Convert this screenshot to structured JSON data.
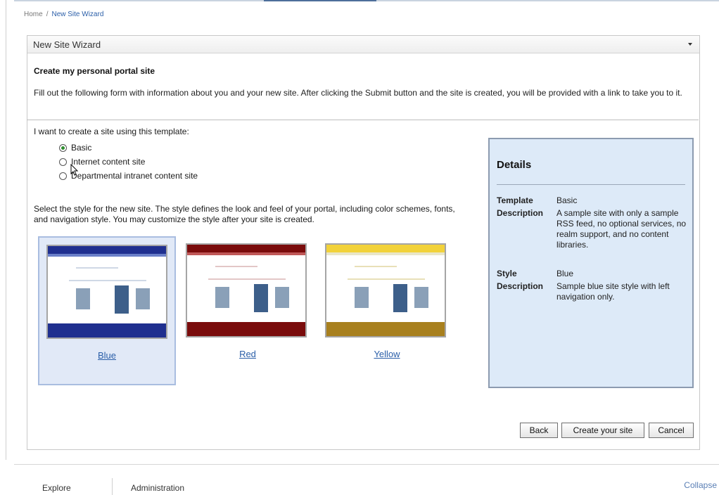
{
  "breadcrumb": {
    "home": "Home",
    "separator": "/",
    "current": "New Site Wizard"
  },
  "panel": {
    "title": "New Site Wizard"
  },
  "page": {
    "subheading": "Create my personal portal site",
    "intro": "Fill out the following form with information about you and your new site. After clicking the Submit button and the site is created, you will be provided with a link to take you to it."
  },
  "template": {
    "prompt": "I want to create a site using this template:",
    "options": [
      {
        "label": "Basic",
        "selected": true
      },
      {
        "label": "Internet content site",
        "selected": false
      },
      {
        "label": "Departmental intranet content site",
        "selected": false
      }
    ]
  },
  "style": {
    "instructions": "Select the style for the new site. The style defines the look and feel of your portal, including color schemes, fonts, and navigation style. You may customize the style after your site is created.",
    "options": [
      {
        "label": "Blue",
        "selected": true,
        "color": "#1f2f8f"
      },
      {
        "label": "Red",
        "selected": false,
        "color": "#7a0c0c"
      },
      {
        "label": "Yellow",
        "selected": false,
        "color": "#a8801e"
      }
    ]
  },
  "details": {
    "title": "Details",
    "template_key": "Template",
    "template_value": "Basic",
    "template_desc_key": "Description",
    "template_desc": "A sample site with only a sample RSS feed, no optional services, no realm support, and no content libraries.",
    "style_key": "Style",
    "style_value": "Blue",
    "style_desc_key": "Description",
    "style_desc": "Sample blue site style with left navigation only."
  },
  "buttons": {
    "back": "Back",
    "create": "Create your site",
    "cancel": "Cancel"
  },
  "footer": {
    "tab_explore": "Explore",
    "tab_admin": "Administration",
    "collapse": "Collapse"
  }
}
